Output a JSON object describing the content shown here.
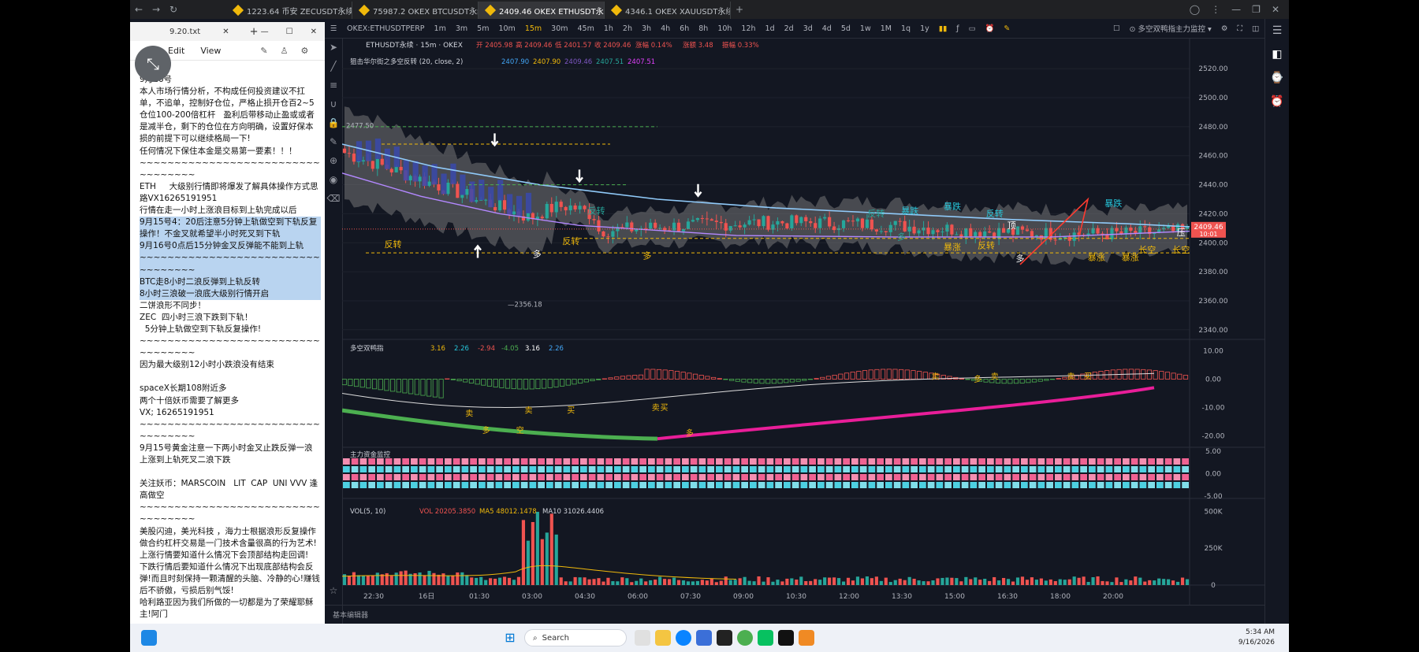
{
  "browser": {
    "tabs": [
      {
        "label": "1223.64 币安 ZECUSDT永续",
        "active": false
      },
      {
        "label": "75987.2 OKEX BTCUSDT永续",
        "active": false
      },
      {
        "label": "2409.46 OKEX ETHUSDT永续",
        "active": true
      },
      {
        "label": "4346.1 OKEX XAUUSDT永续",
        "active": false
      }
    ],
    "new_tab": "+"
  },
  "notepad": {
    "tab_title": "9.20.txt",
    "menu": [
      "Edit",
      "View"
    ],
    "lines": [
      {
        "t": "9月16号"
      },
      {
        "t": "本人市场行情分析，不构成任何投资建议不扛单，不追单，控制好仓位，严格止损开仓百2~5仓位100-200倍杠杆   盈利后带移动止盈或或者是减半仓，剩下的仓位在方向明确，设置好保本损的前提下可以继续格局一下!"
      },
      {
        "t": "任何情况下保住本金是交易第一要素！！！"
      },
      {
        "t": "~~~~~~~~~~~~~~~~~~~~~~~~~~~~~~~~~~"
      },
      {
        "t": "ETH     大级别行情即将爆发了解具体操作方式思路VX16265191951"
      },
      {
        "t": "行情在走一小时上涨浪目标到上轨完成以后"
      },
      {
        "t": "9月15号4：20后注意5分钟上轨做空到下轨反复操作！不金叉就希望半小时死叉到下轨",
        "hl": true
      },
      {
        "t": "9月16号0点后15分钟金叉反弹能不能到上轨",
        "hl": true
      },
      {
        "t": "~~~~~~~~~~~~~~~~~~~~~~~~~~~~~~~~~~",
        "hl": true
      },
      {
        "t": "BTC走8小时二浪反弹到上轨反转",
        "hl": true
      },
      {
        "t": "8小时三浪破一浪底大级别行情开启",
        "hl": true
      },
      {
        "t": "二饼浪形不同步！"
      },
      {
        "t": "ZEC  四小时三浪下跌到下轨！"
      },
      {
        "t": "  5分钟上轨做空到下轨反复操作!"
      },
      {
        "t": "~~~~~~~~~~~~~~~~~~~~~~~~~~~~~~~~~~"
      },
      {
        "t": "因为最大级别12小时小跌浪没有结束"
      },
      {
        "t": ""
      },
      {
        "t": "spaceX长期108附近多"
      },
      {
        "t": "两个十倍妖币需要了解更多"
      },
      {
        "t": "VX; 16265191951"
      },
      {
        "t": "~~~~~~~~~~~~~~~~~~~~~~~~~~~~~~~~~~"
      },
      {
        "t": "9月15号黄金注意一下两小时金叉止跌反弹一浪上涨到上轨死叉二浪下跌"
      },
      {
        "t": ""
      },
      {
        "t": "关注妖币：MARSCOIN   LIT  CAP  UNI VVV 逢高做空"
      },
      {
        "t": "~~~~~~~~~~~~~~~~~~~~~~~~~~~~~~~~~~"
      },
      {
        "t": "美股闪迪，美光科技 ，海力士根据浪形反复操作"
      },
      {
        "t": "做合约杠杆交易是一门技术含量很高的行为艺术!上涨行情要知道什么情况下会顶部结构走回调!"
      },
      {
        "t": "下跌行情后要知道什么情况下出现底部结构会反弹!而且时刻保持一颗清醒的头脑、冷静的心!赚钱后不骄傲，亏损后别气馁!"
      },
      {
        "t": "哈利路亚因为我们所做的一切都是为了荣耀耶稣主!阿门"
      }
    ]
  },
  "tv": {
    "symbol": "OKEX:ETHUSDTPERP",
    "intervals": [
      "1m",
      "3m",
      "5m",
      "10m",
      "15m",
      "30m",
      "45m",
      "1h",
      "2h",
      "3h",
      "4h",
      "6h",
      "8h",
      "10h",
      "12h",
      "1d",
      "2d",
      "3d",
      "4d",
      "5d",
      "1w",
      "1M",
      "1q",
      "1y"
    ],
    "active_interval": "15m",
    "indicator_menu": "多空双鸭指主力监控",
    "legend": {
      "name": "ETHUSDT永续 · 15m · OKEX",
      "open": "开 2405.98",
      "high": "高 2409.46",
      "low": "低 2401.57",
      "close": "收 2409.46",
      "change": "涨幅 0.14%",
      "vol": "涨额 3.48",
      "amp": "振幅 0.33%"
    },
    "indicator1": {
      "name": "狙击华尔街之多空反转 (20, close, 2)",
      "values": [
        "2407.90",
        "2407.90",
        "2409.46",
        "2407.51",
        "2407.51"
      ],
      "colors": [
        "#42a5f5",
        "#f0b90b",
        "#7e57c2",
        "#26a69a",
        "#e040fb"
      ]
    },
    "indicator2": {
      "name": "多空双鸭指",
      "values": [
        "3.16",
        "2.26",
        "-2.94",
        "-4.05",
        "3.16",
        "2.26"
      ],
      "colors": [
        "#f0b90b",
        "#26c6da",
        "#ef5350",
        "#4caf50",
        "#ffffff",
        "#42a5f5"
      ]
    },
    "indicator3": {
      "name": "主力资金监控"
    },
    "indicator4": {
      "name": "VOL(5, 10)",
      "vol": "VOL 20205.3850",
      "ma5": "MA5 48012.1478",
      "ma10": "MA10 31026.4406"
    },
    "price_axis": [
      "2520.00",
      "2500.00",
      "2480.00",
      "2460.00",
      "2440.00",
      "2420.00",
      "2400.00",
      "2380.00",
      "2360.00",
      "2340.00"
    ],
    "last_price": "2409.46",
    "last_countdown": "10:01",
    "osc_axis": [
      "10.00",
      "0.00",
      "-10.00",
      "-20.00"
    ],
    "money_axis": [
      "5.00",
      "0.00",
      "-5.00"
    ],
    "vol_axis": [
      "500K",
      "250K",
      "0"
    ],
    "time_axis": [
      "22:30",
      "16日",
      "01:30",
      "03:00",
      "04:30",
      "06:00",
      "07:30",
      "09:00",
      "10:30",
      "12:00",
      "13:30",
      "15:00",
      "16:30",
      "18:00",
      "20:00"
    ],
    "high_label": "2477.50",
    "low_label": "2356.18",
    "signal_labels": [
      "反转",
      "反转",
      "反转",
      "多",
      "多",
      "多",
      "暴跌",
      "反转",
      "暴涨",
      "暴涨",
      "暴跌",
      "多",
      "反转",
      "长空",
      "长空",
      "暴跌",
      "顶",
      "暴涨",
      "反转",
      "压"
    ],
    "osc_labels": [
      "卖",
      "多",
      "空",
      "多",
      "卖",
      "买",
      "卖",
      "买",
      "多",
      "卖",
      "卖",
      "卖",
      "买"
    ],
    "status": "基本编辑器",
    "colors": {
      "up": "#26a69a",
      "down": "#ef5350",
      "band": "#8a8a8a",
      "ma": "#90caf9",
      "pink": "#e91e99",
      "green": "#4caf50"
    }
  },
  "taskbar": {
    "search": "Search",
    "time": "5:34 AM",
    "date": "9/16/2026"
  }
}
